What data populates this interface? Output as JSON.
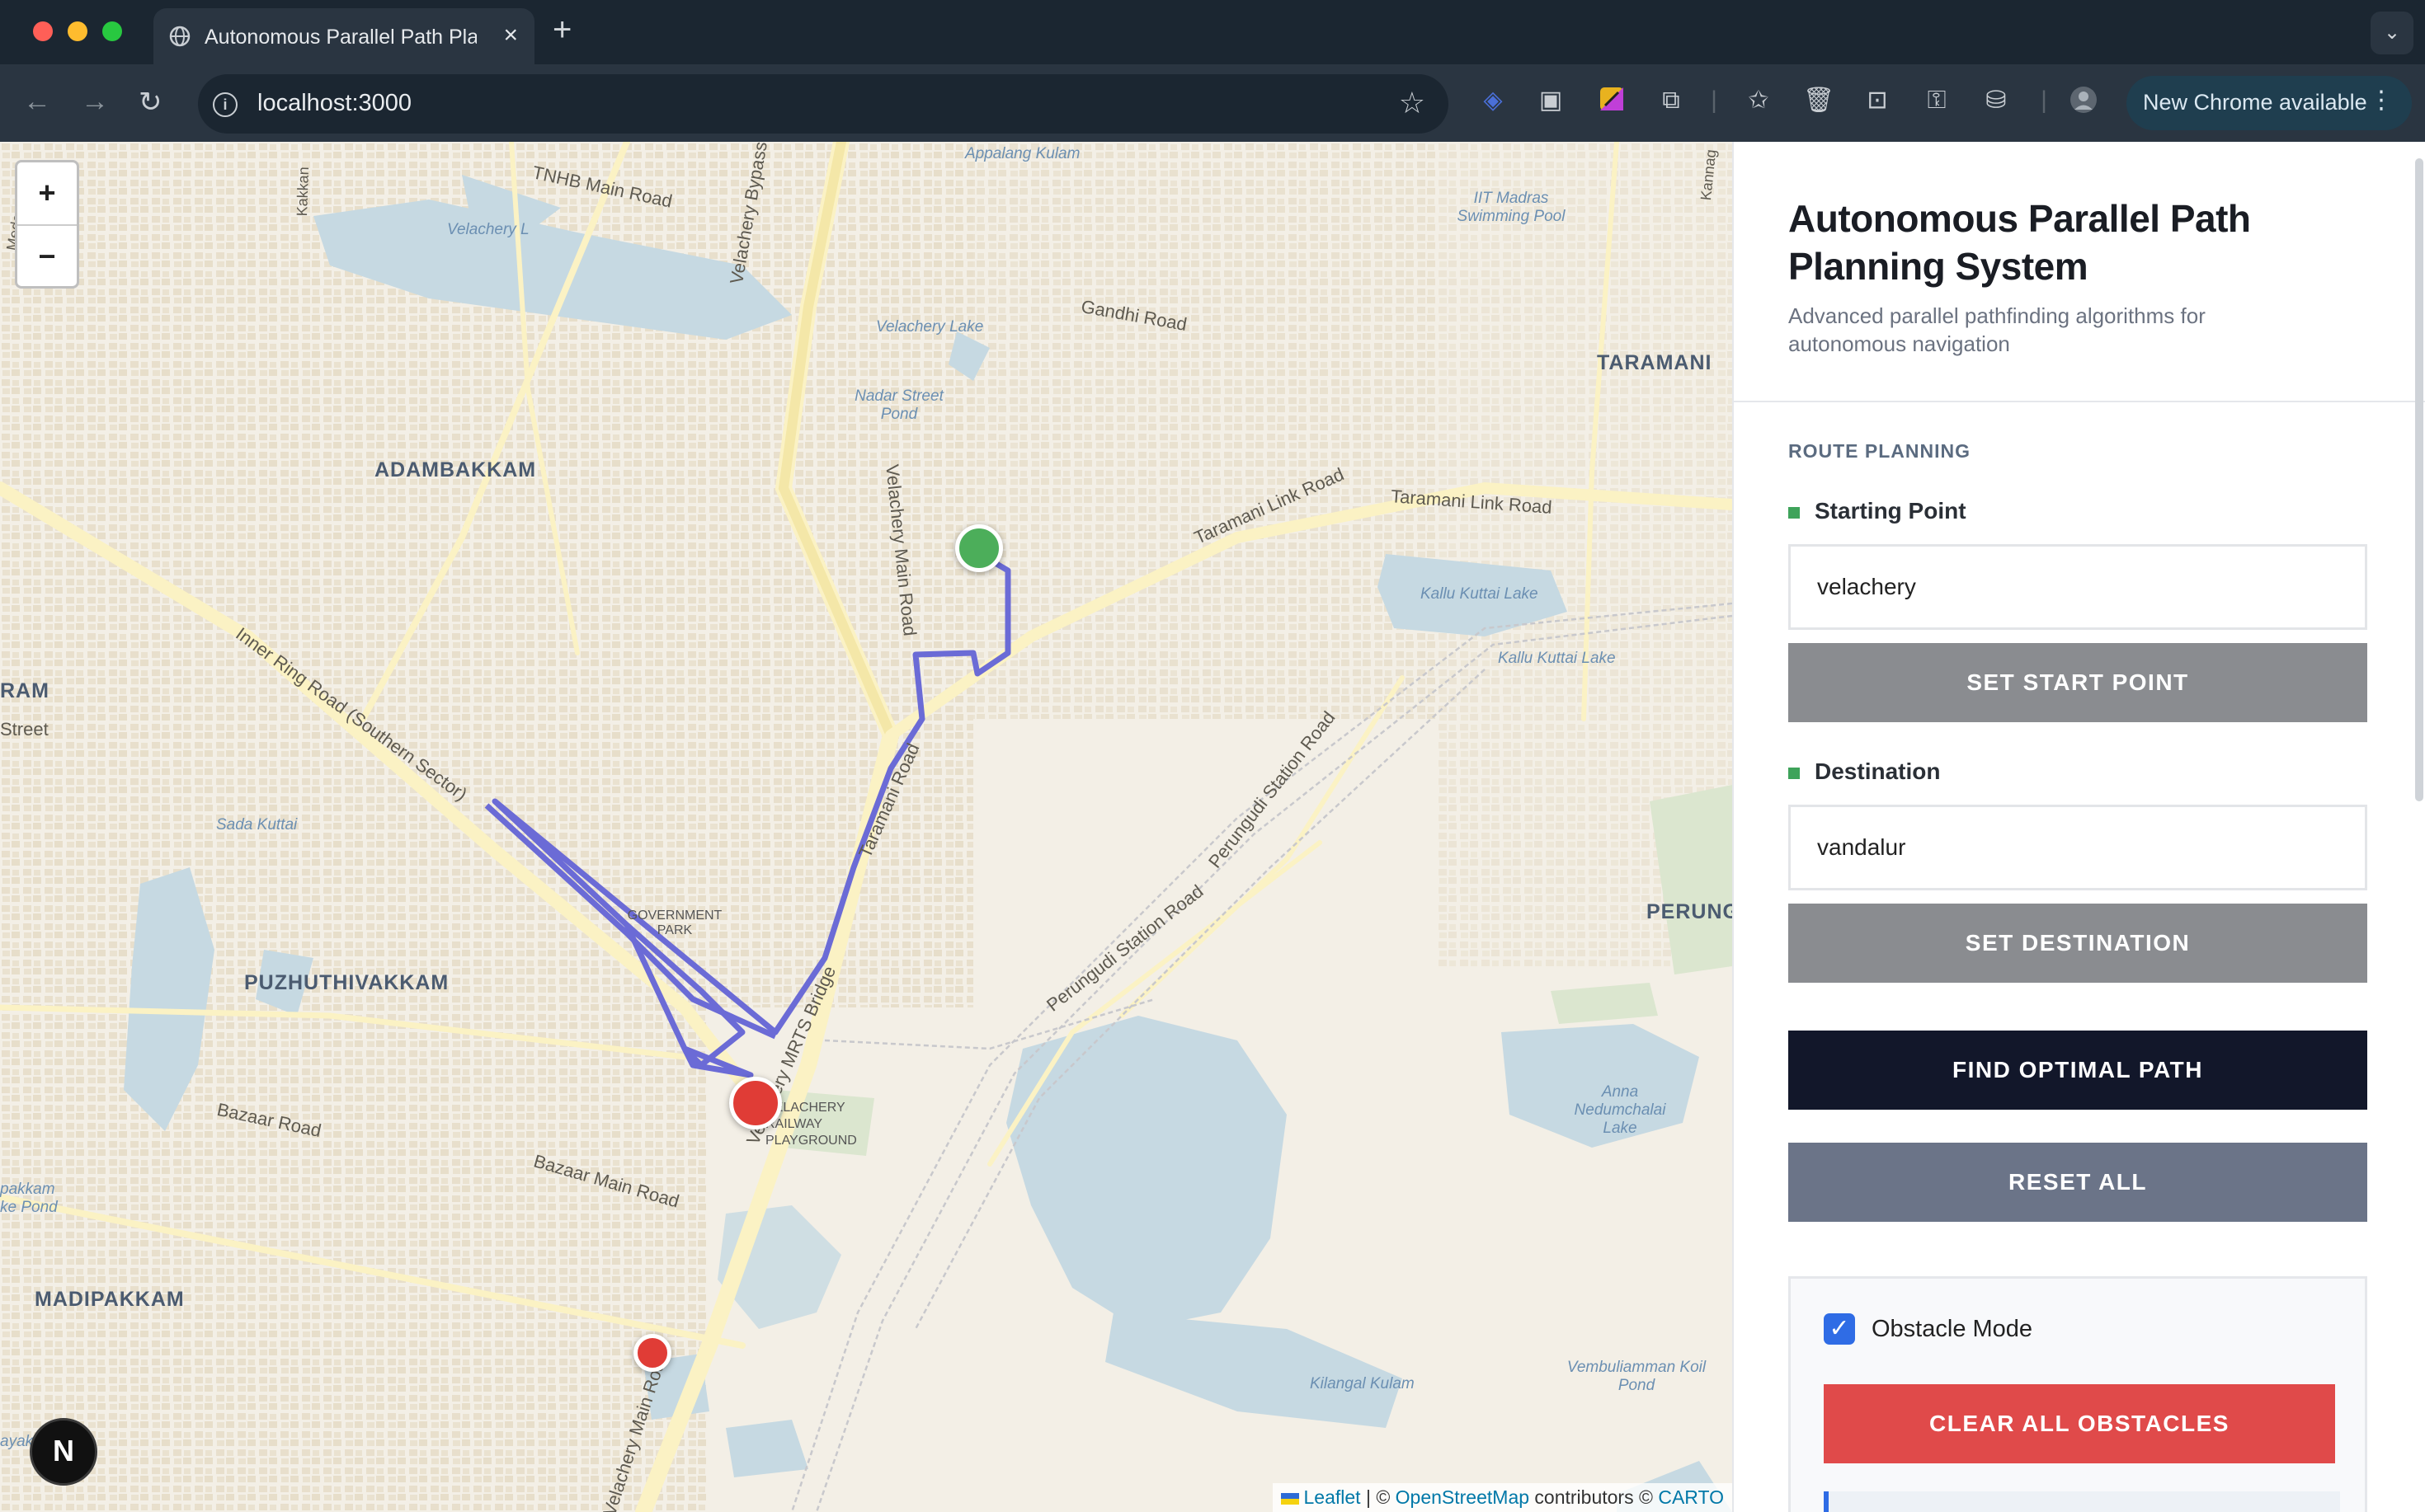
{
  "browser": {
    "tab_title": "Autonomous Parallel Path Planning System",
    "tab_close": "×",
    "new_tab": "+",
    "url": "localhost:3000",
    "update_button": "New Chrome available",
    "more_icon": "⋮"
  },
  "map": {
    "zoom_in": "+",
    "zoom_out": "−",
    "districts": [
      "ADAMBAKKAM",
      "PUZHUTHIVAKKAM",
      "MADIPAKKAM",
      "TARAMANI",
      "PERUNG",
      "RAM"
    ],
    "water_labels": [
      "Appalang Kulam",
      "Velachery L",
      "Velachery Lake",
      "Nadar Street Pond",
      "IIT Madras Swimming Pool",
      "Kallu Kuttai Lake",
      "Kallu Kuttai Lake",
      "Sada Kuttai",
      "Anna Nedumchalai Lake",
      "Kilangal Kulam",
      "Vembuliamman Koil Pond",
      "pakkam ke Pond",
      "ayak ai"
    ],
    "park_labels": [
      "GOVERNMENT PARK",
      "VELACHERY RAILWAY PLAYGROUND"
    ],
    "road_labels": [
      "TNHB Main Road",
      "Velachery Bypass Road",
      "Gandhi Road",
      "Taramani Link Road",
      "Taramani Link Road",
      "Velachery Main Road",
      "Inner Ring Road (Southern Sector)",
      "Taramani Road",
      "Perungudi Station Road",
      "Perungudi Station Road",
      "Velachery MRTS Bridge",
      "Bazaar Road",
      "Bazaar Main Road",
      "Velachery Main Road",
      "Street",
      "Kakkan",
      "Medavakkam",
      "Kannag"
    ],
    "attribution": {
      "leaflet": "Leaflet",
      "sep1": " | © ",
      "osm": "OpenStreetMap",
      "sep2": " contributors © ",
      "carto": "CARTO"
    },
    "nextjs_badge": "N",
    "colors": {
      "route": "#6b6bd6",
      "start_marker": "#4cae5a",
      "end_marker": "#e03c36",
      "obstacle_marker": "#e03c36"
    }
  },
  "panel": {
    "title": "Autonomous Parallel Path Planning System",
    "subtitle": "Advanced parallel pathfinding algorithms for autonomous navigation",
    "section_label": "ROUTE PLANNING",
    "start": {
      "label": "Starting Point",
      "value": "velachery",
      "button": "SET START POINT"
    },
    "destination": {
      "label": "Destination",
      "value": "vandalur",
      "button": "SET DESTINATION"
    },
    "find_button": "FIND OPTIMAL PATH",
    "reset_button": "RESET ALL",
    "obstacle": {
      "checked": true,
      "check_mark": "✓",
      "label": "Obstacle Mode",
      "clear_button": "CLEAR ALL OBSTACLES"
    }
  }
}
